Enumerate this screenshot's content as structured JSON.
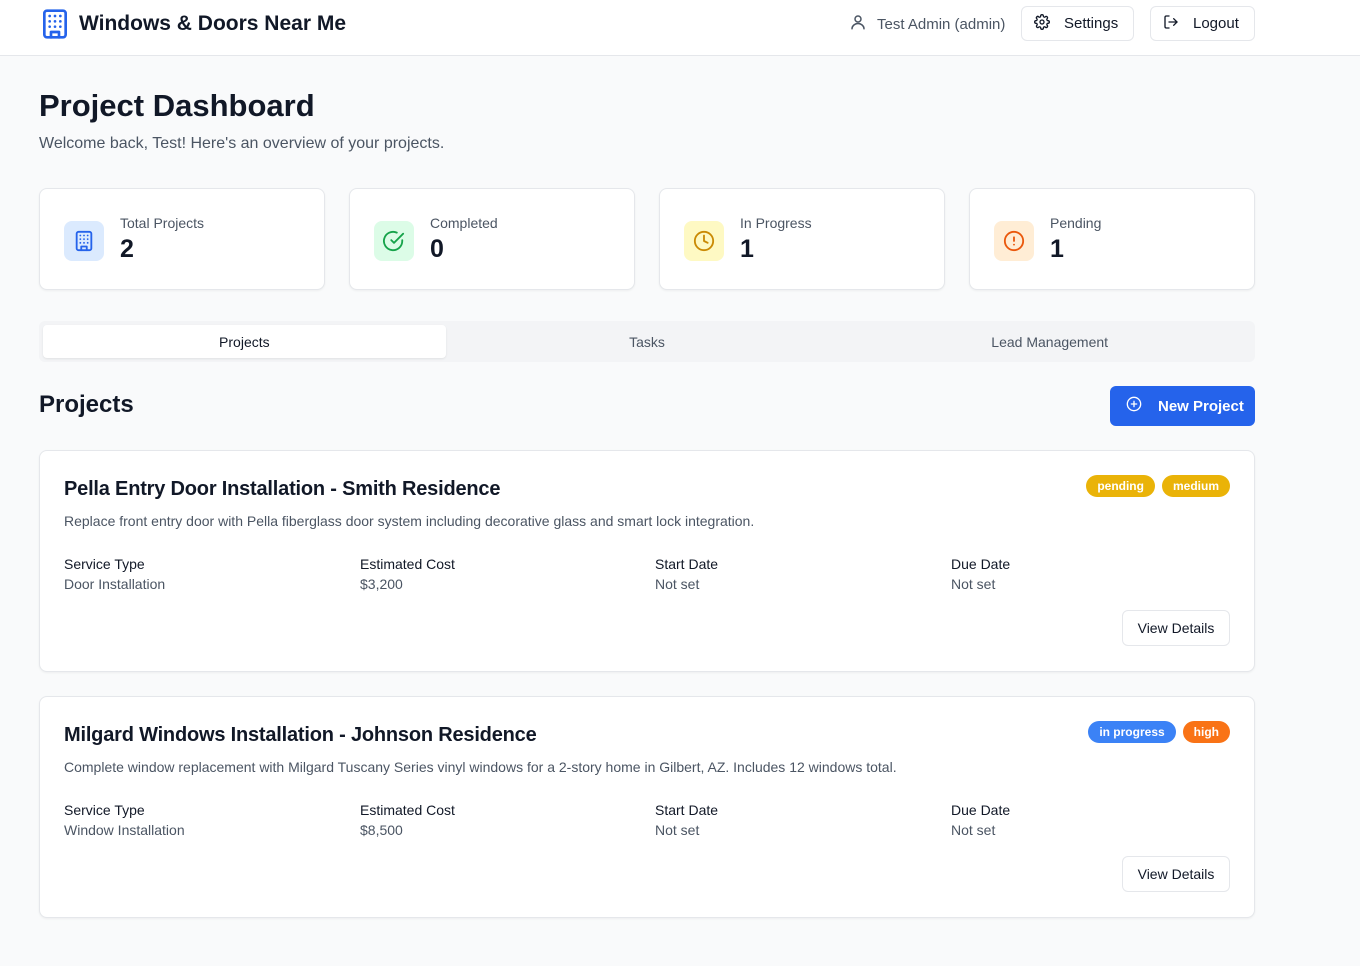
{
  "header": {
    "brand_title": "Windows & Doors Near Me",
    "user_name": "Test Admin (admin)",
    "settings_label": "Settings",
    "logout_label": "Logout"
  },
  "page": {
    "title": "Project Dashboard",
    "subtitle": "Welcome back, Test! Here's an overview of your projects."
  },
  "stats": [
    {
      "label": "Total Projects",
      "value": "2",
      "icon": "building-icon",
      "bg": "#dbeafe",
      "color": "#2563eb"
    },
    {
      "label": "Completed",
      "value": "0",
      "icon": "check-circle-icon",
      "bg": "#dcfce7",
      "color": "#16a34a"
    },
    {
      "label": "In Progress",
      "value": "1",
      "icon": "clock-icon",
      "bg": "#fef9c3",
      "color": "#ca8a04"
    },
    {
      "label": "Pending",
      "value": "1",
      "icon": "alert-circle-icon",
      "bg": "#ffedd5",
      "color": "#ea580c"
    }
  ],
  "tabs": [
    {
      "label": "Projects",
      "active": true
    },
    {
      "label": "Tasks",
      "active": false
    },
    {
      "label": "Lead Management",
      "active": false
    }
  ],
  "projects_section": {
    "title": "Projects",
    "new_button_label": "New Project",
    "accent": "#2563eb"
  },
  "projects": [
    {
      "title": "Pella Entry Door Installation - Smith Residence",
      "description": "Replace front entry door with Pella fiberglass door system including decorative glass and smart lock integration.",
      "status_badge": {
        "text": "pending",
        "color": "#eab308"
      },
      "priority_badge": {
        "text": "medium",
        "color": "#eab308"
      },
      "fields": [
        {
          "label": "Service Type",
          "value": "Door Installation"
        },
        {
          "label": "Estimated Cost",
          "value": "$3,200"
        },
        {
          "label": "Start Date",
          "value": "Not set"
        },
        {
          "label": "Due Date",
          "value": "Not set"
        }
      ],
      "view_label": "View Details"
    },
    {
      "title": "Milgard Windows Installation - Johnson Residence",
      "description": "Complete window replacement with Milgard Tuscany Series vinyl windows for a 2-story home in Gilbert, AZ. Includes 12 windows total.",
      "status_badge": {
        "text": "in progress",
        "color": "#3b82f6"
      },
      "priority_badge": {
        "text": "high",
        "color": "#f97316"
      },
      "fields": [
        {
          "label": "Service Type",
          "value": "Window Installation"
        },
        {
          "label": "Estimated Cost",
          "value": "$8,500"
        },
        {
          "label": "Start Date",
          "value": "Not set"
        },
        {
          "label": "Due Date",
          "value": "Not set"
        }
      ],
      "view_label": "View Details"
    }
  ]
}
